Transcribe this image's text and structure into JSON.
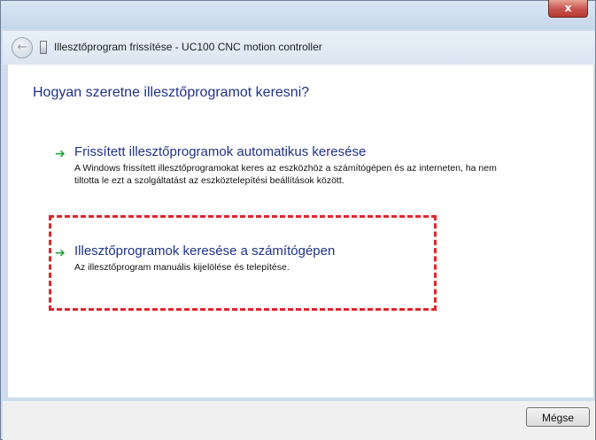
{
  "window": {
    "close_label": "x"
  },
  "navbar": {
    "back_label": "←",
    "title": "Illesztőprogram frissítése - UC100 CNC motion controller"
  },
  "content": {
    "heading": "Hogyan szeretne illesztőprogramot keresni?",
    "options": [
      {
        "arrow": "➔",
        "title": "Frissített illesztőprogramok automatikus keresése",
        "description": "A Windows frissített illesztőprogramokat keres az eszközhöz a számítógépen és az interneten, ha nem tiltotta le ezt a szolgáltatást az eszköztelepítési beállítások között."
      },
      {
        "arrow": "➔",
        "title": "Illesztőprogramok keresése a számítógépen",
        "description": "Az illesztőprogram manuális kijelölése és telepítése."
      }
    ]
  },
  "footer": {
    "cancel_label": "Mégse"
  },
  "colors": {
    "heading": "#1e3287",
    "arrow": "#1fa53a",
    "highlight_box": "#e0262c"
  }
}
